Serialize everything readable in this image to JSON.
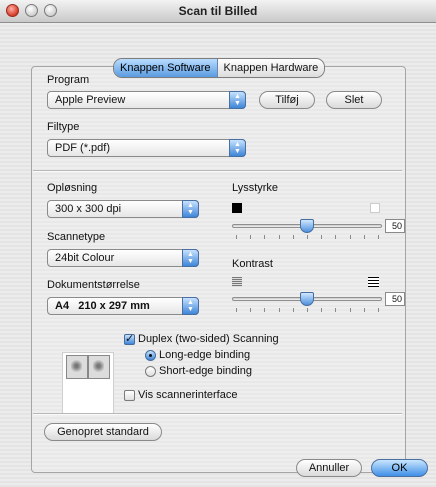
{
  "window": {
    "title": "Scan til Billed"
  },
  "tabs": [
    {
      "label": "Knappen Software",
      "selected": true
    },
    {
      "label": "Knappen Hardware",
      "selected": false
    }
  ],
  "program": {
    "label": "Program",
    "value": "Apple Preview",
    "add_button": "Tilføj",
    "delete_button": "Slet"
  },
  "filetype": {
    "label": "Filtype",
    "value": "PDF (*.pdf)"
  },
  "resolution": {
    "label": "Opløsning",
    "value": "300 x 300 dpi"
  },
  "scantype": {
    "label": "Scannetype",
    "value": "24bit Colour"
  },
  "docsize": {
    "label": "Dokumentstørrelse",
    "value": "A4   210 x 297 mm"
  },
  "brightness": {
    "label": "Lysstyrke",
    "value": "50",
    "level": 0.5
  },
  "contrast": {
    "label": "Kontrast",
    "value": "50",
    "level": 0.5
  },
  "duplex": {
    "label": "Duplex (two-sided) Scanning",
    "checked": true,
    "long_edge": "Long-edge binding",
    "short_edge": "Short-edge binding",
    "selected": "long_edge"
  },
  "scanner_interface": {
    "label": "Vis scannerinterface",
    "checked": false
  },
  "buttons": {
    "restore": "Genopret standard",
    "cancel": "Annuller",
    "ok": "OK"
  },
  "colors": {
    "accent": "#4a90e2",
    "window_bg": "#e8e8e8"
  }
}
